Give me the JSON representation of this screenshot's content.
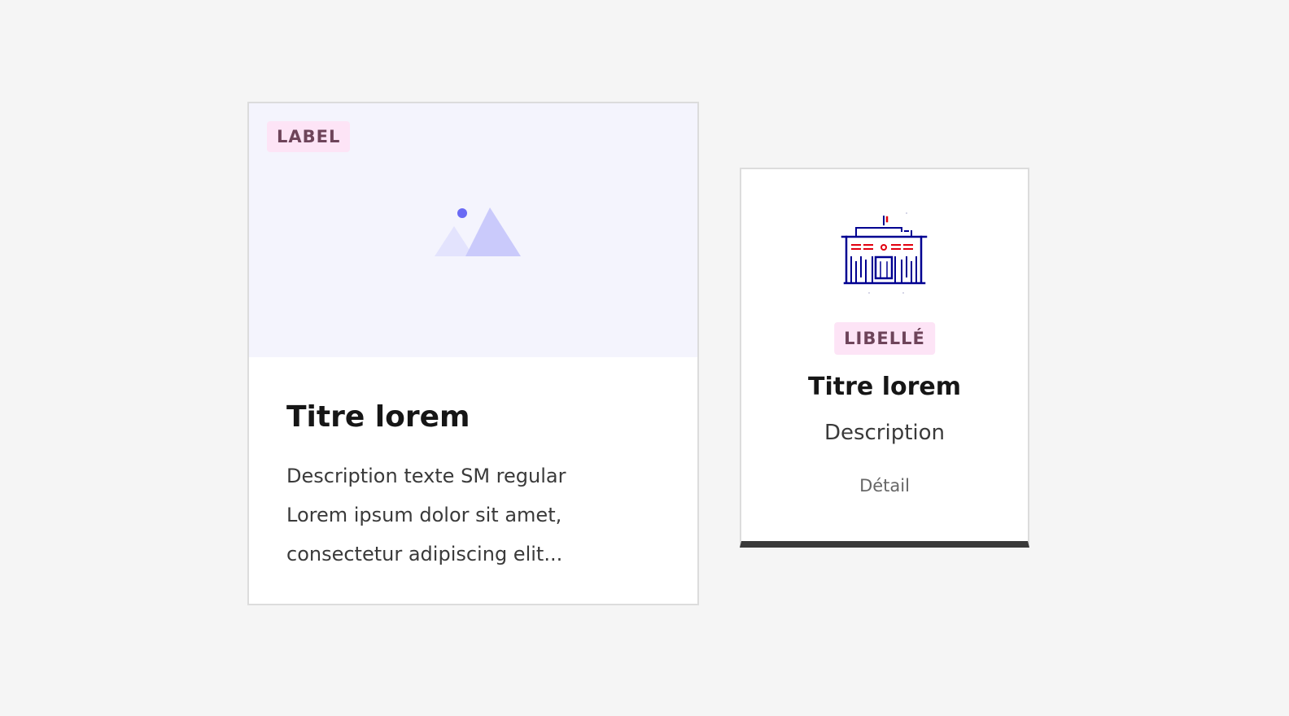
{
  "card_image": {
    "badge": "LABEL",
    "title": "Titre lorem",
    "description_lines": [
      "Description texte SM regular",
      "Lorem ipsum dolor sit amet,",
      "consectetur adipiscing elit..."
    ],
    "media_icon": "image-placeholder-icon"
  },
  "card_tile": {
    "badge": "LIBELLÉ",
    "title": "Titre lorem",
    "description": "Description",
    "detail": "Détail",
    "icon": "city-hall-icon"
  },
  "colors": {
    "page_background": "#f5f5f5",
    "media_background": "#f4f4fd",
    "badge_background": "#fde4f6",
    "badge_text": "#6e445a",
    "title_text": "#161616",
    "body_text": "#3a3a3a",
    "tile_bottom_border": "#3a3a3a",
    "pictogram_blue": "#000091",
    "pictogram_red": "#e1000f"
  }
}
